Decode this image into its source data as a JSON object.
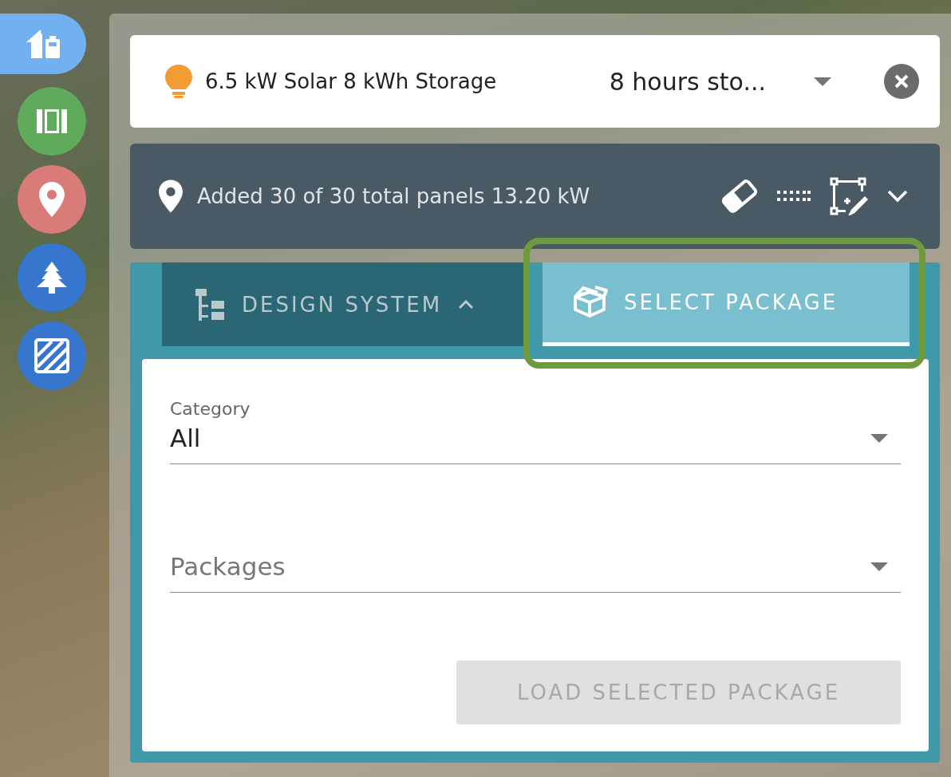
{
  "rail": [
    {
      "kind": "home-battery",
      "color": "#72b1f0",
      "selected": true
    },
    {
      "kind": "panels",
      "color": "#5fab5b",
      "selected": false
    },
    {
      "kind": "pin",
      "color": "#d97b78",
      "selected": false
    },
    {
      "kind": "tree",
      "color": "#3676cf",
      "selected": false
    },
    {
      "kind": "hatch",
      "color": "#3676cf",
      "selected": false
    }
  ],
  "system_bar": {
    "title": "6.5 kW Solar 8 kWh Storage",
    "storage_select": "8 hours sto..."
  },
  "panel_bar": {
    "status": "Added 30 of 30 total panels 13.20 kW"
  },
  "tabs": [
    {
      "label": "DESIGN SYSTEM",
      "kind": "design",
      "selected": false,
      "highlighted": false
    },
    {
      "label": "SELECT PACKAGE",
      "kind": "package",
      "selected": true,
      "highlighted": true
    }
  ],
  "form": {
    "category": {
      "label": "Category",
      "value": "All"
    },
    "packages": {
      "placeholder": "Packages"
    },
    "load_button": {
      "label": "LOAD SELECTED PACKAGE",
      "disabled": true
    }
  }
}
